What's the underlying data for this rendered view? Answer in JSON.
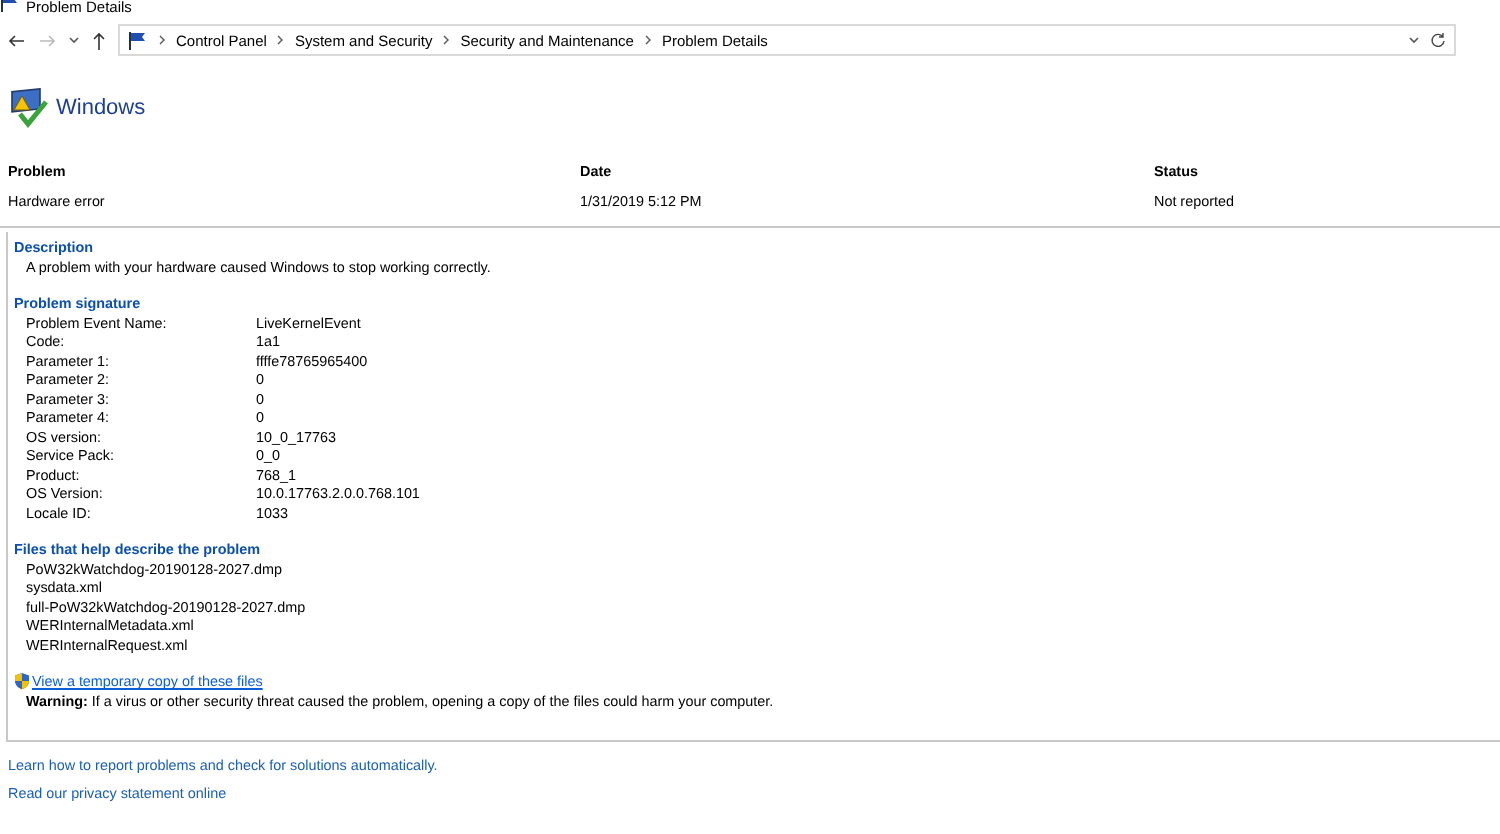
{
  "window": {
    "title": "Problem Details"
  },
  "address": {
    "crumbs": [
      "Control Panel",
      "System and Security",
      "Security and Maintenance",
      "Problem Details"
    ]
  },
  "brand": {
    "title": "Windows"
  },
  "summary": [
    {
      "header": "Problem",
      "value": "Hardware error"
    },
    {
      "header": "Date",
      "value": "1/31/2019 5:12 PM"
    },
    {
      "header": "Status",
      "value": "Not reported"
    }
  ],
  "description": {
    "heading": "Description",
    "text": "A problem with your hardware caused Windows to stop working correctly."
  },
  "signature": {
    "heading": "Problem signature",
    "rows": [
      {
        "label": "Problem Event Name:",
        "value": "LiveKernelEvent"
      },
      {
        "label": "Code:",
        "value": "1a1"
      },
      {
        "label": "Parameter 1:",
        "value": "ffffe78765965400"
      },
      {
        "label": "Parameter 2:",
        "value": "0"
      },
      {
        "label": "Parameter 3:",
        "value": "0"
      },
      {
        "label": "Parameter 4:",
        "value": "0"
      },
      {
        "label": "OS version:",
        "value": "10_0_17763"
      },
      {
        "label": "Service Pack:",
        "value": "0_0"
      },
      {
        "label": "Product:",
        "value": "768_1"
      },
      {
        "label": "OS Version:",
        "value": "10.0.17763.2.0.0.768.101"
      },
      {
        "label": "Locale ID:",
        "value": "1033"
      }
    ]
  },
  "files": {
    "heading": "Files that help describe the problem",
    "items": [
      "PoW32kWatchdog-20190128-2027.dmp",
      "sysdata.xml",
      "full-PoW32kWatchdog-20190128-2027.dmp",
      "WERInternalMetadata.xml",
      "WERInternalRequest.xml"
    ]
  },
  "copy_link": "View a temporary copy of these files",
  "warning": "**Warning:** If a virus or other security threat caused the problem, opening a copy of the files could harm your computer.",
  "footer_links": [
    "Learn how to report problems and check for solutions automatically.",
    "Read our privacy statement online"
  ]
}
